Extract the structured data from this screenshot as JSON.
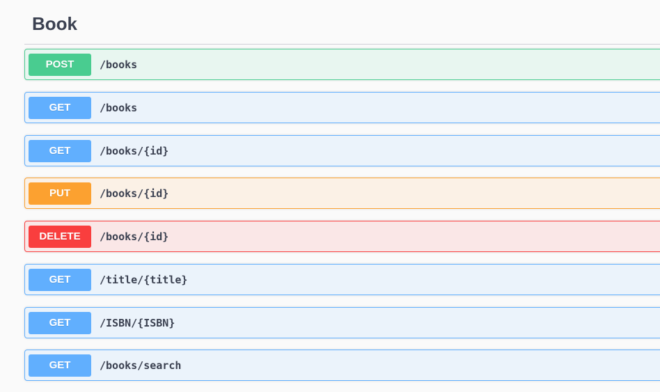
{
  "tag": {
    "name": "Book"
  },
  "operations": [
    {
      "method": "POST",
      "path": "/books",
      "badge_color": "#49cc90",
      "bg_color": "#e8f6f0",
      "border_color": "#49cc90"
    },
    {
      "method": "GET",
      "path": "/books",
      "badge_color": "#61affe",
      "bg_color": "#ebf3fb",
      "border_color": "#61affe"
    },
    {
      "method": "GET",
      "path": "/books/{id}",
      "badge_color": "#61affe",
      "bg_color": "#ebf3fb",
      "border_color": "#61affe"
    },
    {
      "method": "PUT",
      "path": "/books/{id}",
      "badge_color": "#fca130",
      "bg_color": "#fbf1e6",
      "border_color": "#fca130"
    },
    {
      "method": "DELETE",
      "path": "/books/{id}",
      "badge_color": "#f93e3e",
      "bg_color": "#fae7e7",
      "border_color": "#f93e3e"
    },
    {
      "method": "GET",
      "path": "/title/{title}",
      "badge_color": "#61affe",
      "bg_color": "#ebf3fb",
      "border_color": "#61affe"
    },
    {
      "method": "GET",
      "path": "/ISBN/{ISBN}",
      "badge_color": "#61affe",
      "bg_color": "#ebf3fb",
      "border_color": "#61affe"
    },
    {
      "method": "GET",
      "path": "/books/search",
      "badge_color": "#61affe",
      "bg_color": "#ebf3fb",
      "border_color": "#61affe"
    }
  ]
}
